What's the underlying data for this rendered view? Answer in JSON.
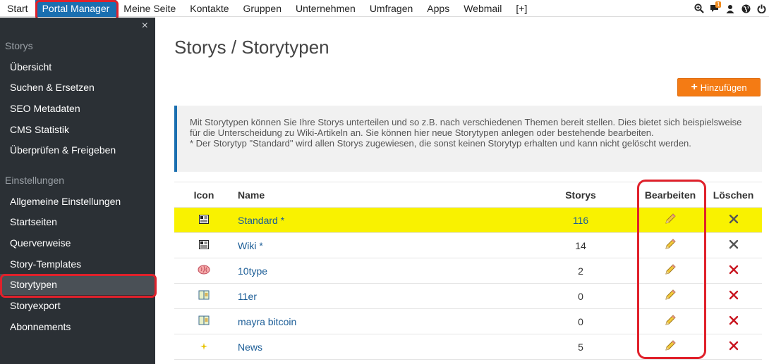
{
  "topnav": {
    "items": [
      "Start",
      "Portal Manager",
      "Meine Seite",
      "Kontakte",
      "Gruppen",
      "Unternehmen",
      "Umfragen",
      "Apps",
      "Webmail",
      "[+]"
    ],
    "active_index": 1,
    "right_icons": [
      "zoom-icon",
      "chat-icon",
      "user-icon",
      "globe-icon",
      "power-icon"
    ],
    "chat_badge": "1"
  },
  "sidebar": {
    "close": "×",
    "section_storys": "Storys",
    "storys_items": [
      "Übersicht",
      "Suchen & Ersetzen",
      "SEO Metadaten",
      "CMS Statistik",
      "Überprüfen & Freigeben"
    ],
    "section_settings": "Einstellungen",
    "settings_items": [
      "Allgemeine Einstellungen",
      "Startseiten",
      "Querverweise",
      "Story-Templates",
      "Storytypen",
      "Storyexport",
      "Abonnements"
    ],
    "active_item": "Storytypen"
  },
  "main": {
    "title": "Storys / Storytypen",
    "add_button": "Hinzufügen",
    "info_line1": "Mit Storytypen können Sie Ihre Storys unterteilen und so z.B. nach verschiedenen Themen bereit stellen. Dies bietet sich beispielsweise für die Unterscheidung zu Wiki-Artikeln an. Sie können hier neue Storytypen anlegen oder bestehende bearbeiten.",
    "info_line2": "* Der Storytyp \"Standard\" wird allen Storys zugewiesen, die sonst keinen Storytyp erhalten und kann nicht gelöscht werden."
  },
  "table": {
    "headers": {
      "icon": "Icon",
      "name": "Name",
      "storys": "Storys",
      "edit": "Bearbeiten",
      "delete": "Löschen"
    },
    "rows": [
      {
        "icon": "newspaper-icon",
        "name": "Standard *",
        "storys": "116",
        "highlight": true,
        "deletable": false
      },
      {
        "icon": "newspaper-icon",
        "name": "Wiki *",
        "storys": "14",
        "highlight": false,
        "deletable": false
      },
      {
        "icon": "brain-icon",
        "name": "10type",
        "storys": "2",
        "highlight": false,
        "deletable": true
      },
      {
        "icon": "book-icon",
        "name": "11er",
        "storys": "0",
        "highlight": false,
        "deletable": true
      },
      {
        "icon": "book-icon",
        "name": "mayra bitcoin",
        "storys": "0",
        "highlight": false,
        "deletable": true
      },
      {
        "icon": "star-icon",
        "name": "News",
        "storys": "5",
        "highlight": false,
        "deletable": true
      }
    ]
  },
  "colors": {
    "accent": "#1a6fb0",
    "add_button": "#f47b14",
    "highlight_row": "#f9f200",
    "annotation": "#e0212b",
    "sidebar_bg": "#2b3035"
  }
}
